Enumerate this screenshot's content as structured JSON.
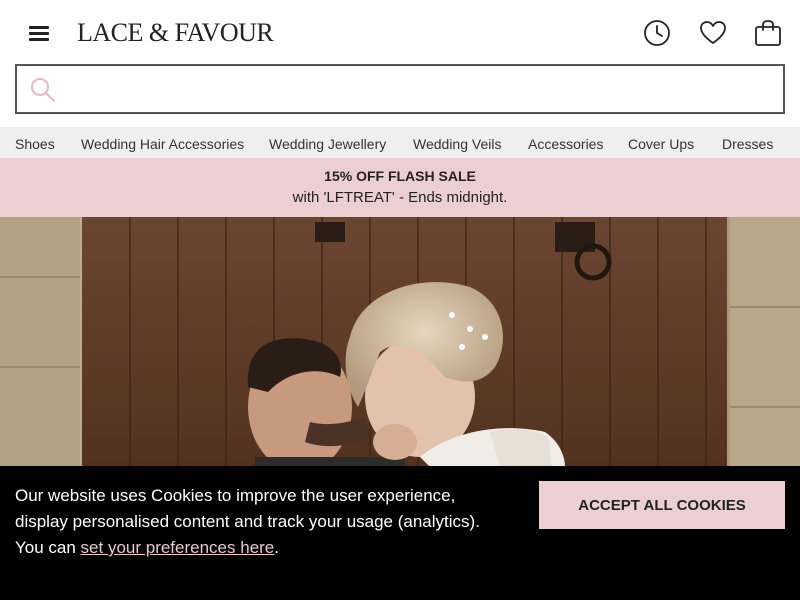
{
  "header": {
    "logo": "LACE & FAVOUR",
    "icons": [
      "menu-icon",
      "history-icon",
      "heart-icon",
      "bag-icon"
    ]
  },
  "search": {
    "placeholder": "",
    "value": ""
  },
  "nav": {
    "items": [
      "Shoes",
      "Wedding Hair Accessories",
      "Wedding Jewellery",
      "Wedding Veils",
      "Accessories",
      "Cover Ups",
      "Dresses"
    ]
  },
  "promo": {
    "title": "15% OFF FLASH SALE",
    "subtitle": "with 'LFTREAT' - Ends midnight."
  },
  "hero": {
    "image": "couple-kissing-photo"
  },
  "cookie": {
    "text_1": "Our website uses Cookies to improve the user experience, display personalised content and track your usage (analytics).",
    "text_2_prefix": "You can ",
    "link": "set your preferences here",
    "text_2_suffix": ".",
    "accept_label": "ACCEPT ALL COOKIES"
  },
  "colors": {
    "accent_pink": "#ebcfd3",
    "nav_bg": "#efefef",
    "banner_bg": "#000000"
  }
}
